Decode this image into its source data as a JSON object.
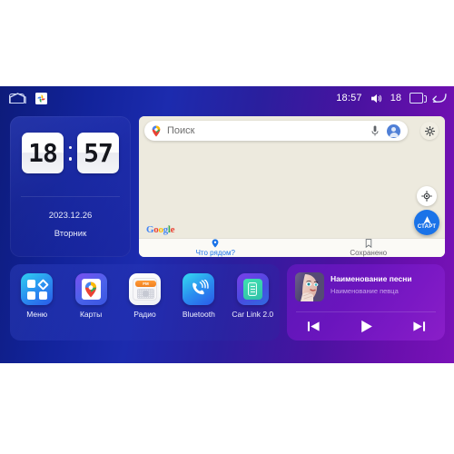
{
  "statusbar": {
    "home_icon": "home-icon",
    "photos_icon": "google-photos-icon",
    "time": "18:57",
    "volume_icon": "volume-icon",
    "volume_level": "18",
    "recent_icon": "recent-apps-icon",
    "back_icon": "back-arrow-icon"
  },
  "clock": {
    "hours": "18",
    "minutes": "57",
    "date": "2023.12.26",
    "weekday": "Вторник"
  },
  "maps": {
    "search_placeholder": "Поиск",
    "pin_icon": "map-pin-icon",
    "mic_icon": "microphone-icon",
    "avatar_icon": "account-avatar-icon",
    "settings_icon": "settings-icon",
    "locate_icon": "my-location-icon",
    "start_label": "СТАРТ",
    "google_logo": {
      "l1": "G",
      "l2": "o",
      "l3": "o",
      "l4": "g",
      "l5": "l",
      "l6": "e"
    },
    "tabs": [
      {
        "label": "Что рядом?",
        "icon": "pin-icon",
        "active": true
      },
      {
        "label": "Сохранено",
        "icon": "bookmark-icon",
        "active": false
      }
    ]
  },
  "apps": [
    {
      "label": "Меню",
      "icon": "menu-grid-icon"
    },
    {
      "label": "Карты",
      "icon": "google-maps-icon"
    },
    {
      "label": "Радио",
      "icon": "radio-icon",
      "band": "FM"
    },
    {
      "label": "Bluetooth",
      "icon": "bluetooth-phone-icon"
    },
    {
      "label": "Car Link 2.0",
      "icon": "car-link-icon"
    }
  ],
  "music": {
    "title": "Наименование песни",
    "artist": "Наименование певца",
    "album_art": "album-art-portrait",
    "prev_icon": "previous-track-icon",
    "play_icon": "play-icon",
    "next_icon": "next-track-icon"
  },
  "colors": {
    "bg_left": "#0d1b7a",
    "bg_right": "#7a12b8",
    "map_bg": "#eeeadd",
    "accent_blue": "#1a73e8",
    "music_purple": "#6a15bd"
  }
}
